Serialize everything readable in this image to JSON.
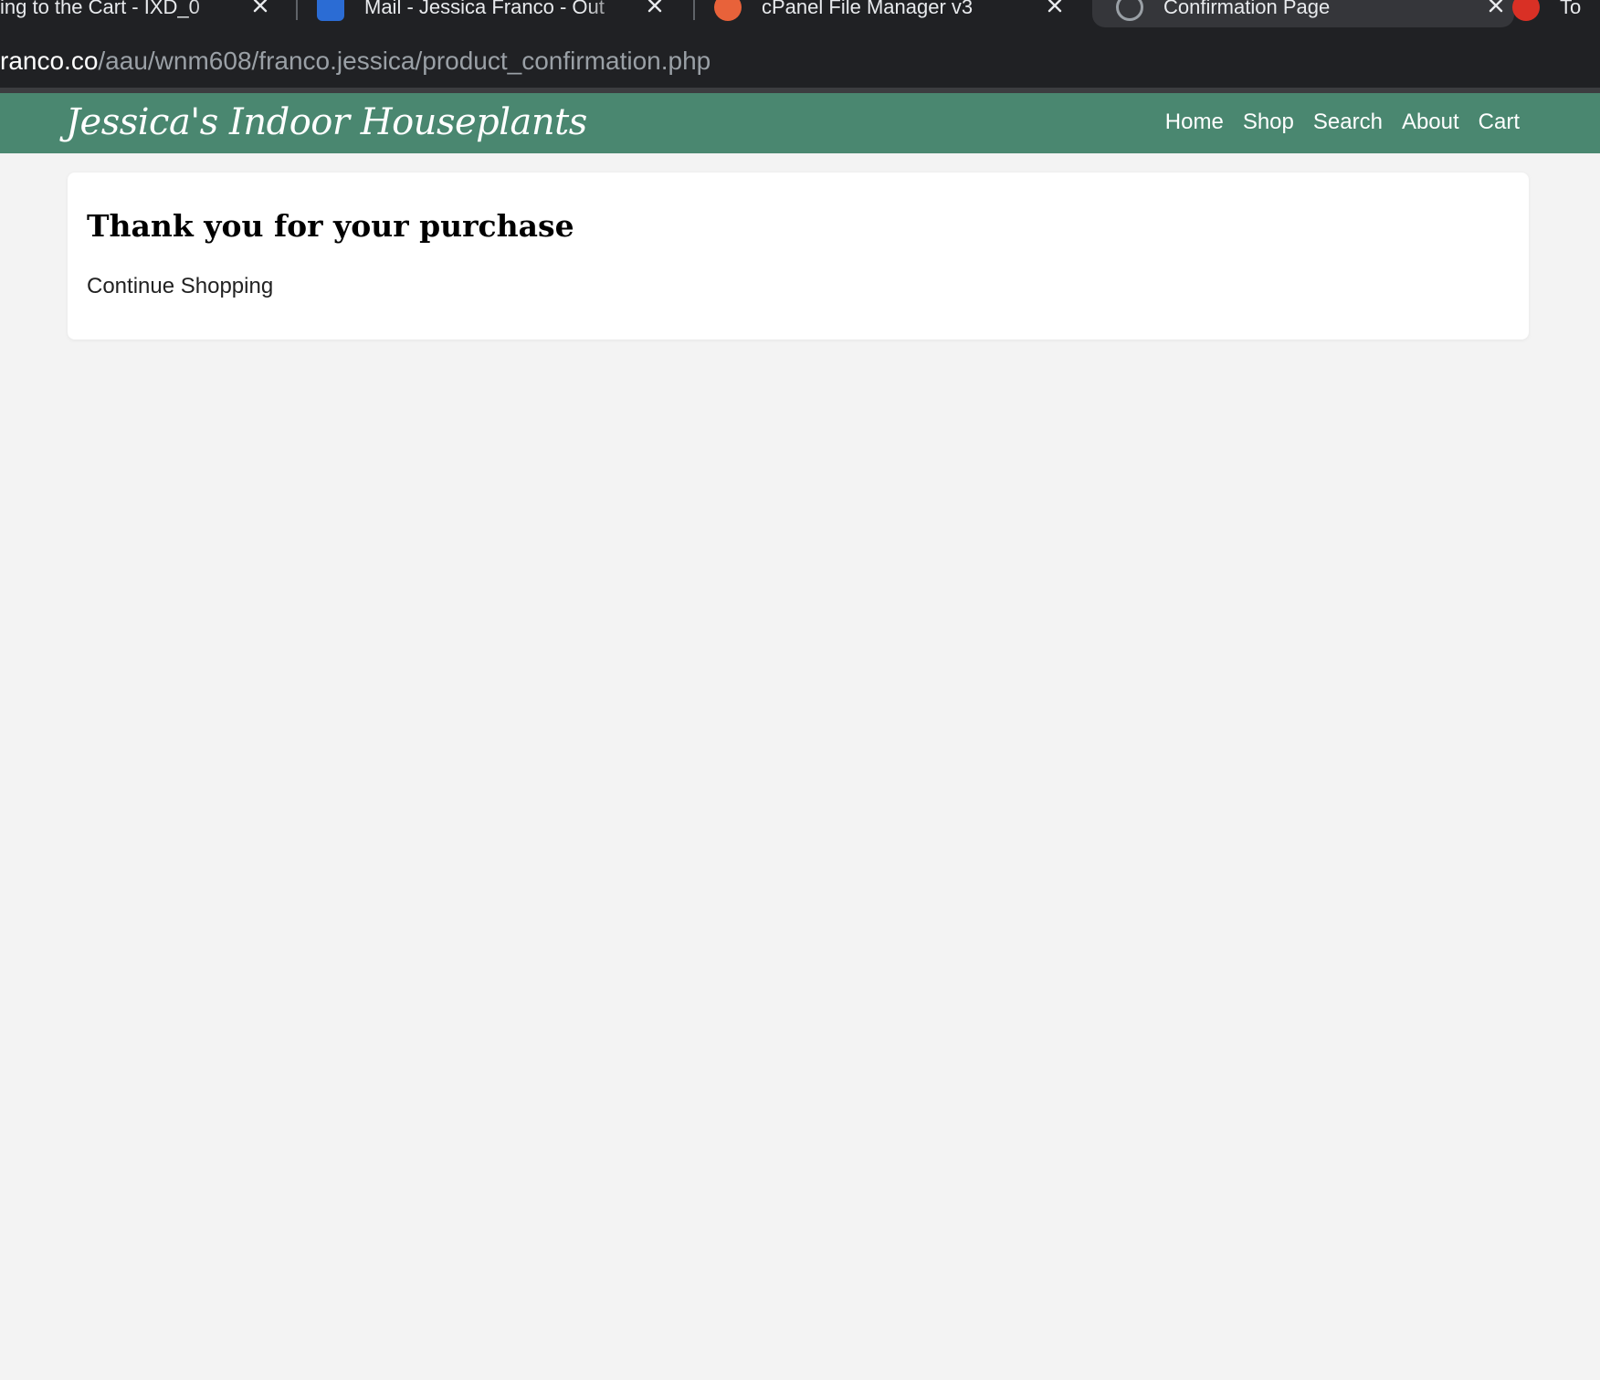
{
  "browser": {
    "tabs": [
      {
        "title": "ing to the Cart - IXD_0",
        "favicon": "none",
        "active": false
      },
      {
        "title": "Mail - Jessica Franco - Out",
        "favicon": "outlook-mail-icon",
        "active": false
      },
      {
        "title": "cPanel File Manager v3",
        "favicon": "cpanel-icon",
        "active": false
      },
      {
        "title": "Confirmation Page",
        "favicon": "globe-icon",
        "active": true
      },
      {
        "title": "To",
        "favicon": "red-app-icon",
        "active": false
      }
    ],
    "url_host": "ranco.co",
    "url_path": "/aau/wnm608/franco.jessica/product_confirmation.php"
  },
  "site": {
    "brand": "Jessica's Indoor Houseplants",
    "nav": [
      "Home",
      "Shop",
      "Search",
      "About",
      "Cart"
    ],
    "colors": {
      "header_bg": "#4a8770",
      "page_bg": "#f3f3f3",
      "card_bg": "#ffffff"
    }
  },
  "main": {
    "heading": "Thank you for your purchase",
    "continue_link": "Continue Shopping"
  }
}
